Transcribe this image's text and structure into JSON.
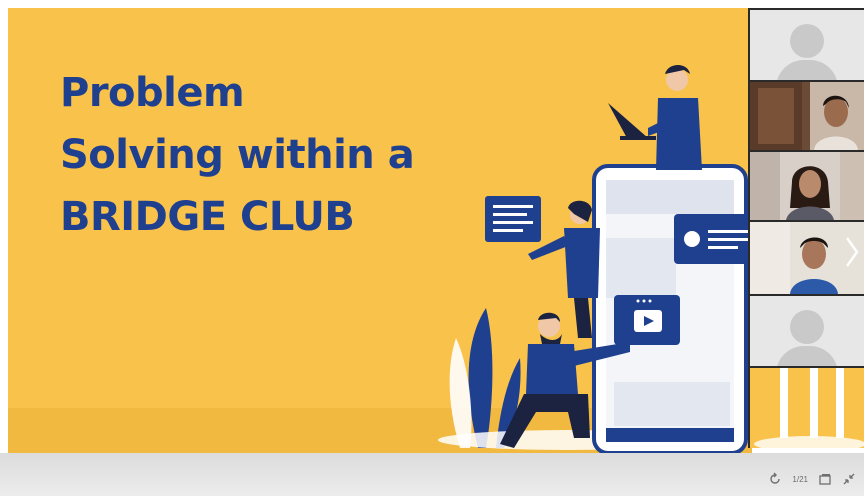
{
  "slide": {
    "title_lines": [
      "Problem",
      "Solving within a",
      "BRIDGE CLUB"
    ],
    "background_color": "#f9c24a",
    "title_color": "#1f3f8f",
    "accent_color": "#1f3f8f"
  },
  "video_tiles": [
    {
      "type": "placeholder",
      "icon": "user-avatar-icon"
    },
    {
      "type": "camera",
      "description_icon": "participant-video-icon"
    },
    {
      "type": "camera",
      "description_icon": "participant-video-icon"
    },
    {
      "type": "camera",
      "description_icon": "participant-video-icon"
    },
    {
      "type": "placeholder",
      "icon": "user-avatar-icon"
    }
  ],
  "controls": {
    "page_indicator": "1/21",
    "icons": [
      "refresh-icon",
      "layout-icon",
      "collapse-icon"
    ]
  },
  "navigation": {
    "next_icon": "chevron-right-icon"
  }
}
